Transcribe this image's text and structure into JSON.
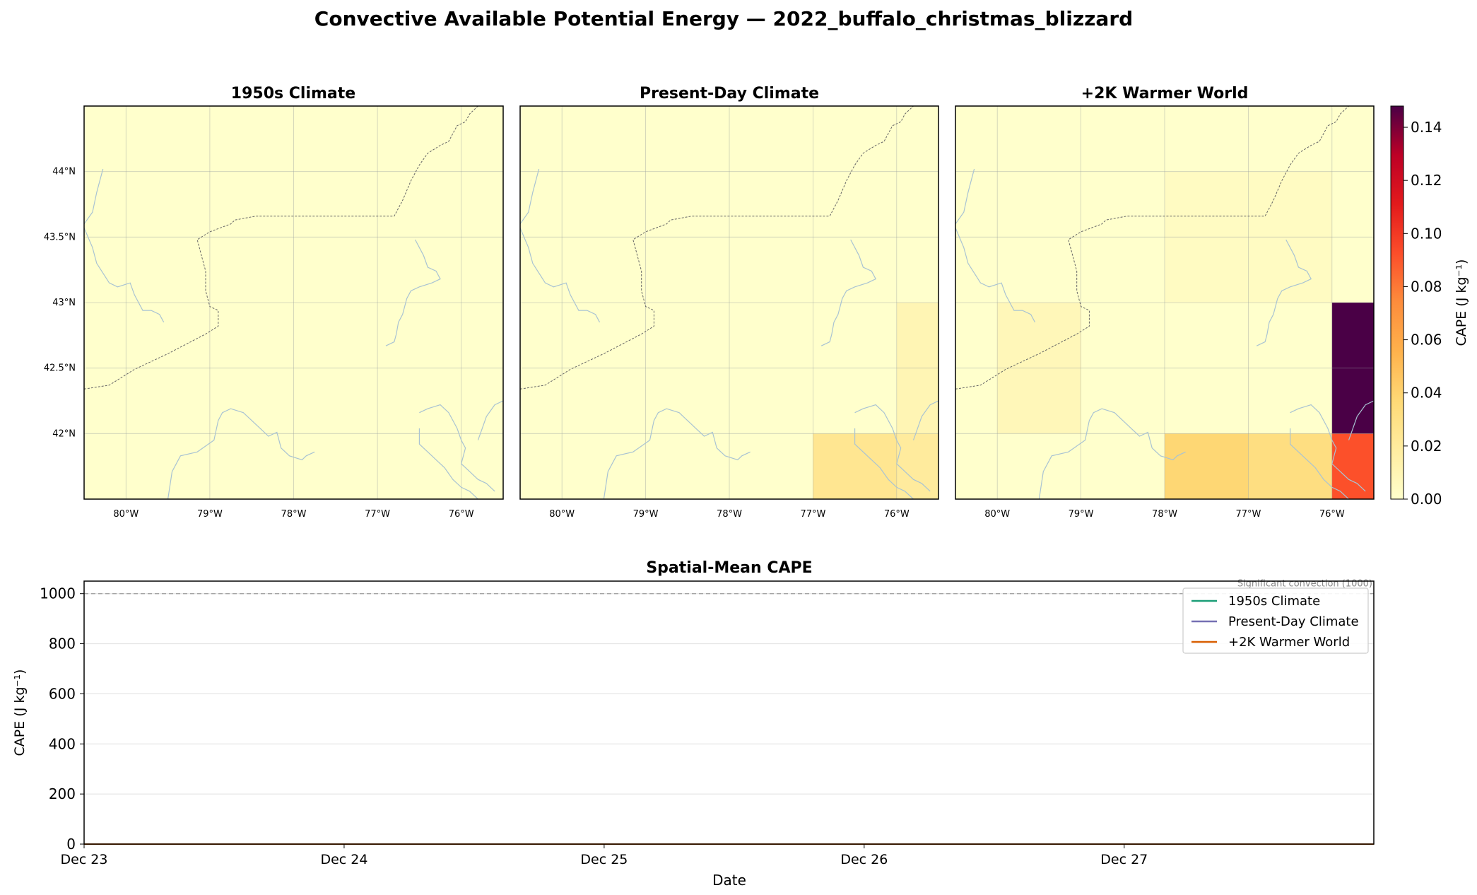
{
  "figure": {
    "suptitle": "Convective Available Potential Energy — 2022_buffalo_christmas_blizzard"
  },
  "chart_data": [
    {
      "type": "heatmap",
      "title": "1950s Climate",
      "lon_edges": [
        -80.5,
        -79.5,
        -78.5,
        -77.5,
        -76.5,
        -75.5
      ],
      "lat_edges": [
        41.5,
        42.0,
        43.0,
        44.0,
        44.5
      ],
      "lon_ticks": [
        -80,
        -79,
        -78,
        -77,
        -76
      ],
      "lon_tick_labels": [
        "80°W",
        "79°W",
        "78°W",
        "77°W",
        "76°W"
      ],
      "lat_ticks": [
        42,
        42.5,
        43,
        43.5,
        44
      ],
      "lat_tick_labels": [
        "42°N",
        "42.5°N",
        "43°N",
        "43.5°N",
        "44°N"
      ],
      "cells": [],
      "background_value": 0.0
    },
    {
      "type": "heatmap",
      "title": "Present-Day Climate",
      "lon_edges": [
        -80.5,
        -79.5,
        -78.5,
        -77.5,
        -76.5,
        -75.5
      ],
      "lat_edges": [
        41.5,
        42.0,
        43.0,
        44.0,
        44.5
      ],
      "lon_ticks": [
        -80,
        -79,
        -78,
        -77,
        -76
      ],
      "lon_tick_labels": [
        "80°W",
        "79°W",
        "78°W",
        "77°W",
        "76°W"
      ],
      "lat_ticks": [
        42,
        42.5,
        43,
        43.5,
        44
      ],
      "lat_tick_labels": [
        "",
        "",
        "",
        "",
        ""
      ],
      "cells": [
        {
          "lon": [
            -77.0,
            -76.0
          ],
          "lat": [
            41.5,
            42.0
          ],
          "value": 0.025
        },
        {
          "lon": [
            -76.0,
            -75.5
          ],
          "lat": [
            41.5,
            42.0
          ],
          "value": 0.02
        },
        {
          "lon": [
            -76.0,
            -75.5
          ],
          "lat": [
            42.0,
            43.0
          ],
          "value": 0.01
        }
      ],
      "background_value": 0.0
    },
    {
      "type": "heatmap",
      "title": "+2K Warmer World",
      "lon_edges": [
        -80.5,
        -79.5,
        -78.5,
        -77.5,
        -76.5,
        -75.5
      ],
      "lat_edges": [
        41.5,
        42.0,
        43.0,
        44.0,
        44.5
      ],
      "lon_ticks": [
        -80,
        -79,
        -78,
        -77,
        -76
      ],
      "lon_tick_labels": [
        "80°W",
        "79°W",
        "78°W",
        "77°W",
        "76°W"
      ],
      "lat_ticks": [
        42,
        42.5,
        43,
        43.5,
        44
      ],
      "lat_tick_labels": [
        "",
        "",
        "",
        "",
        ""
      ],
      "cells": [
        {
          "lon": [
            -80.0,
            -79.0
          ],
          "lat": [
            42.0,
            43.0
          ],
          "value": 0.008
        },
        {
          "lon": [
            -80.0,
            -79.0
          ],
          "lat": [
            42.5,
            43.0
          ],
          "value": 0.008
        },
        {
          "lon": [
            -78.0,
            -76.0
          ],
          "lat": [
            43.0,
            44.0
          ],
          "value": 0.004
        },
        {
          "lon": [
            -78.0,
            -77.0
          ],
          "lat": [
            41.5,
            42.0
          ],
          "value": 0.038
        },
        {
          "lon": [
            -77.0,
            -76.0
          ],
          "lat": [
            41.5,
            42.0
          ],
          "value": 0.032
        },
        {
          "lon": [
            -76.0,
            -75.5
          ],
          "lat": [
            41.5,
            42.0
          ],
          "value": 0.092
        },
        {
          "lon": [
            -76.0,
            -75.5
          ],
          "lat": [
            42.0,
            43.0
          ],
          "value": 0.148
        }
      ],
      "background_value": 0.0
    },
    {
      "type": "line",
      "title": "Spatial-Mean CAPE",
      "xlabel": "Date",
      "ylabel": "CAPE (J kg⁻¹)",
      "x_ticks": [
        "Dec 23",
        "Dec 24",
        "Dec 25",
        "Dec 26",
        "Dec 27"
      ],
      "x_range_days": [
        0,
        4.96
      ],
      "ylim": [
        0,
        1050
      ],
      "y_ticks": [
        0,
        200,
        400,
        600,
        800,
        1000
      ],
      "grid": true,
      "reference_line": {
        "y": 1000,
        "label": "Significant convection (1000)"
      },
      "legend_position": "top-right",
      "series": [
        {
          "name": "1950s Climate",
          "color": "#1b9e77",
          "x_days": [
            0,
            1,
            2,
            3,
            4,
            4.96
          ],
          "values": [
            0,
            0,
            0,
            0,
            0,
            0
          ]
        },
        {
          "name": "Present-Day Climate",
          "color": "#7570b3",
          "x_days": [
            0,
            1,
            2,
            3,
            4,
            4.96
          ],
          "values": [
            0,
            0,
            0,
            0,
            0,
            0
          ]
        },
        {
          "name": "+2K Warmer World",
          "color": "#d95f02",
          "x_days": [
            0,
            1,
            2,
            3,
            4,
            4.96
          ],
          "values": [
            0,
            0,
            0,
            0,
            0,
            0
          ]
        }
      ]
    }
  ],
  "colorbar": {
    "label": "CAPE (J kg⁻¹)",
    "cmap": "YlOrRd",
    "range": [
      0,
      0.148
    ],
    "ticks": [
      0.0,
      0.02,
      0.04,
      0.06,
      0.08,
      0.1,
      0.12,
      0.14
    ],
    "tick_labels": [
      "0.00",
      "0.02",
      "0.04",
      "0.06",
      "0.08",
      "0.10",
      "0.12",
      "0.14"
    ]
  }
}
